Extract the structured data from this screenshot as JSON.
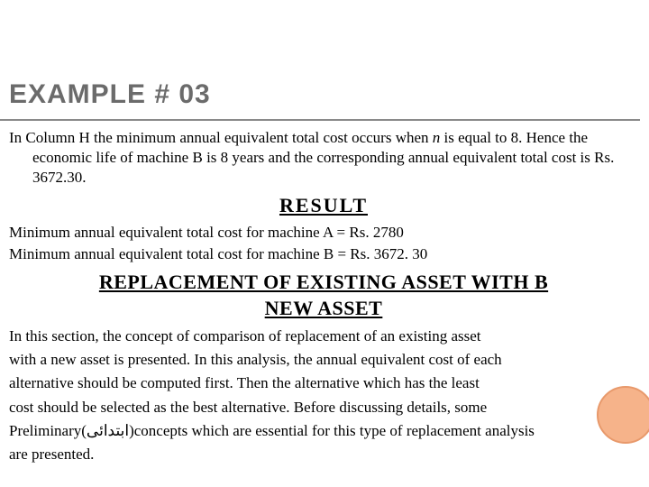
{
  "title": "EXAMPLE # 03",
  "intro": {
    "line1_pre": "In Column H the minimum annual equivalent total cost occurs when ",
    "n_var": "n",
    "line1_post": " is equal to 8. Hence the economic life of machine B is 8 years and the corresponding annual equivalent total cost is Rs. 3672.30."
  },
  "result": {
    "heading": "RESULT",
    "lineA": "Minimum annual equivalent total cost for machine A = Rs. 2780",
    "lineB": "Minimum annual equivalent total cost for machine B = Rs. 3672. 30"
  },
  "replace_heading_line1": "REPLACEMENT OF EXISTING ASSET WITH B",
  "replace_heading_line2": "NEW ASSET",
  "section": {
    "l1": "In this section, the concept of comparison of replacement of an existing asset",
    "l2": "with a new asset is presented. In this analysis, the annual equivalent cost of each",
    "l3": "alternative should be computed first. Then the alternative which has the least",
    "l4": "cost should be selected as the best alternative. Before discussing details, some",
    "l5_pre": "Preliminary(",
    "l5_ar": "ابتدائی",
    "l5_post": ")concepts which are essential for this type of replacement analysis",
    "l6": "are presented."
  }
}
